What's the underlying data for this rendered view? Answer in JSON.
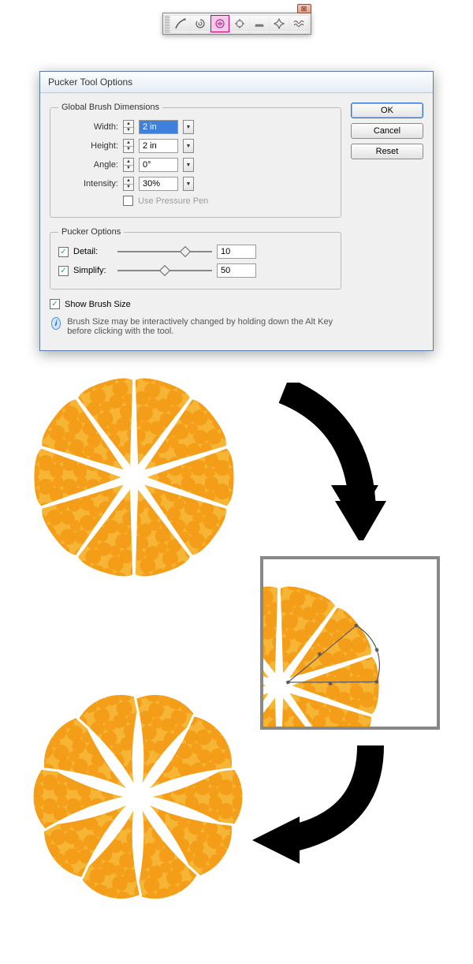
{
  "toolbar": {
    "tools": [
      "warp",
      "twirl",
      "pucker",
      "bloat",
      "scallop",
      "crystallize",
      "wrinkle"
    ],
    "selected_index": 2
  },
  "dialog": {
    "title": "Pucker Tool Options",
    "brush_legend": "Global Brush Dimensions",
    "width_label": "Width:",
    "width_value": "2 in",
    "height_label": "Height:",
    "height_value": "2 in",
    "angle_label": "Angle:",
    "angle_value": "0°",
    "intensity_label": "Intensity:",
    "intensity_value": "30%",
    "pressure_label": "Use Pressure Pen",
    "pucker_legend": "Pucker Options",
    "detail_label": "Detail:",
    "detail_value": "10",
    "simplify_label": "Simplify:",
    "simplify_value": "50",
    "show_brush_label": "Show Brush Size",
    "info_text": "Brush Size may be interactively changed by holding down the Alt Key before clicking with the tool.",
    "ok": "OK",
    "cancel": "Cancel",
    "reset": "Reset"
  }
}
